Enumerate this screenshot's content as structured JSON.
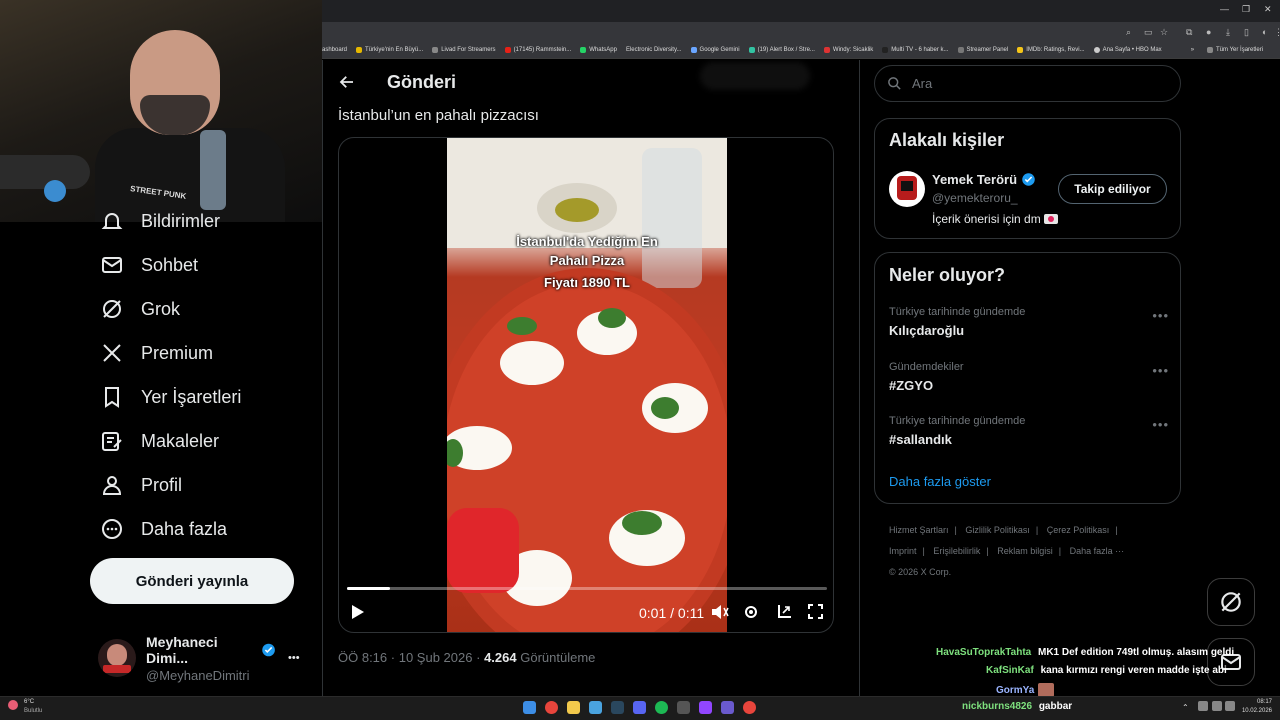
{
  "bookmarks": [
    "ashboard",
    "Türkiye'nin En Büyü...",
    "Livad For Streamers",
    "(17145) Rammstein...",
    "WhatsApp",
    "Electronic Diversity...",
    "Google Gemini",
    "(19) Alert Box / Stre...",
    "Windy: Sicaklik",
    "Multi TV - 6 haber k...",
    "Streamer Panel",
    "IMDb: Ratings, Revi...",
    "Ana Sayfa • HBO Max",
    "Tüm Yer İşaretleri"
  ],
  "webcam": {
    "shirt_text": "STREET PUNK"
  },
  "nav": {
    "items": [
      {
        "label": "Bildirimler",
        "icon": "bell-icon"
      },
      {
        "label": "Sohbet",
        "icon": "mail-icon"
      },
      {
        "label": "Grok",
        "icon": "grok-icon"
      },
      {
        "label": "Premium",
        "icon": "x-logo-icon"
      },
      {
        "label": "Yer İşaretleri",
        "icon": "bookmark-icon"
      },
      {
        "label": "Makaleler",
        "icon": "article-icon"
      },
      {
        "label": "Profil",
        "icon": "person-icon"
      },
      {
        "label": "Daha fazla",
        "icon": "more-circle-icon"
      }
    ],
    "post_button": "Gönderi yayınla"
  },
  "account": {
    "name": "Meyhaneci Dimi...",
    "handle": "@MeyhaneDimitri",
    "more": "•••"
  },
  "main": {
    "header_title": "Gönderi",
    "tweet_text": "İstanbul’un en pahalı pizzacısı",
    "video": {
      "overlay_line1": "İstanbul'da Yediğim En",
      "overlay_line2": "Pahalı Pizza",
      "overlay_line3": "Fiyatı 1890 TL",
      "time": "0:01 / 0:11",
      "progress": 0.09
    },
    "meta": {
      "time": "ÖÖ 8:16",
      "date": "10 Şub 2026",
      "views": "4.264",
      "views_label": "Görüntüleme",
      "sep": "·"
    }
  },
  "right": {
    "search_placeholder": "Ara",
    "related": {
      "title": "Alakalı kişiler",
      "name": "Yemek Terörü",
      "handle": "@yemekteroru_",
      "bio": "İçerik önerisi için dm",
      "follow_label": "Takip ediliyor"
    },
    "trends": {
      "title": "Neler oluyor?",
      "items": [
        {
          "context": "Türkiye tarihinde gündemde",
          "name": "Kılıçdaroğlu"
        },
        {
          "context": "Gündemdekiler",
          "name": "#ZGYO"
        },
        {
          "context": "Türkiye tarihinde gündemde",
          "name": "#sallandık"
        }
      ],
      "show_more": "Daha fazla göster"
    },
    "footer": {
      "links": [
        "Hizmet Şartları",
        "|",
        "Gizlilik Politikası",
        "|",
        "Çerez Politikası",
        "|",
        "Imprint",
        "|",
        "Erişilebilirlik",
        "|",
        "Reklam bilgisi",
        "|",
        "Daha fazla ···"
      ],
      "copyright": "© 2026 X Corp."
    }
  },
  "chat": [
    {
      "user": "HavaSuToprakTahta",
      "color": "#7ee07e",
      "msg": "MK1 Def edition 749tl olmuş. alasım geldi"
    },
    {
      "user": "KafSinKaf",
      "color": "#7ee07e",
      "msg": "kana kırmızı rengi veren madde işte abi"
    },
    {
      "user": "GormYa",
      "color": "#9ab4ff",
      "msg": ""
    },
    {
      "user": "nickburns4826",
      "color": "#7ee07e",
      "msg": "gabbar"
    }
  ],
  "taskbar": {
    "weather_temp": "6°C",
    "weather_label": "Bulutlu",
    "clock_time": "08:17",
    "clock_date": "10.02.2026"
  },
  "colors": {
    "accent": "#1d9bf0",
    "bg": "#000000",
    "border": "#2f3336",
    "muted": "#71767b"
  }
}
